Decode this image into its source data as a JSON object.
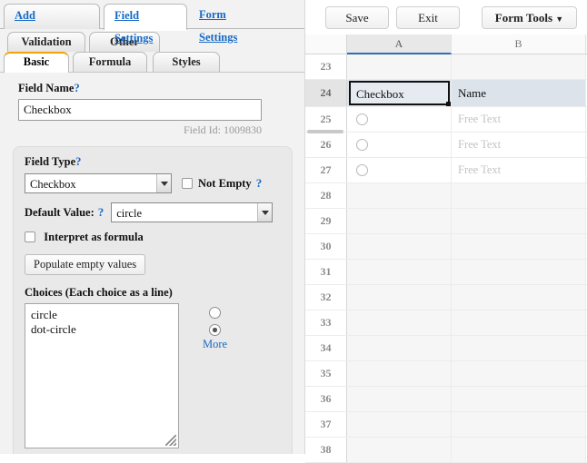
{
  "left_panel": {
    "top_tabs": [
      {
        "label": "Add Components",
        "active": false
      },
      {
        "label": "Field Settings",
        "active": true
      },
      {
        "label": "Form Settings",
        "active": false
      }
    ],
    "sub_tabs_row1": [
      {
        "label": "Validation"
      },
      {
        "label": "Other"
      }
    ],
    "sub_tabs_row2": [
      {
        "label": "Basic",
        "active": true
      },
      {
        "label": "Formula",
        "active": false
      },
      {
        "label": "Styles",
        "active": false
      }
    ],
    "field_name": {
      "label": "Field Name",
      "help": "?",
      "value": "Checkbox",
      "field_id_text": "Field Id: 1009830"
    },
    "field_type": {
      "label": "Field Type",
      "help": "?",
      "value": "Checkbox",
      "not_empty_label": "Not Empty",
      "not_empty_help": "?",
      "not_empty_checked": false
    },
    "default_value": {
      "label": "Default Value:",
      "help": "?",
      "value": "circle",
      "interpret_label": "Interpret as formula",
      "interpret_checked": false
    },
    "populate_button": "Populate empty values",
    "choices": {
      "label": "Choices (Each choice as a line)",
      "value": "circle\ndot-circle",
      "preview_icons": [
        "circle",
        "dot-circle"
      ],
      "more_label": "More"
    }
  },
  "right_panel": {
    "toolbar": {
      "save": "Save",
      "exit": "Exit",
      "form_tools": "Form Tools",
      "form_tools_caret": "▼"
    },
    "grid": {
      "columns": [
        {
          "label": "A",
          "selected": true
        },
        {
          "label": "B",
          "selected": false
        }
      ],
      "rows": [
        {
          "num": "23",
          "type": "empty",
          "a": "",
          "b": ""
        },
        {
          "num": "24",
          "type": "header",
          "a": "Checkbox",
          "b": "Name"
        },
        {
          "num": "25",
          "type": "data",
          "a": "radio",
          "b": "Free Text"
        },
        {
          "num": "26",
          "type": "data",
          "a": "radio",
          "b": "Free Text"
        },
        {
          "num": "27",
          "type": "data",
          "a": "radio",
          "b": "Free Text"
        },
        {
          "num": "28",
          "type": "empty",
          "a": "",
          "b": ""
        },
        {
          "num": "29",
          "type": "empty",
          "a": "",
          "b": ""
        },
        {
          "num": "30",
          "type": "empty",
          "a": "",
          "b": ""
        },
        {
          "num": "31",
          "type": "empty",
          "a": "",
          "b": ""
        },
        {
          "num": "32",
          "type": "empty",
          "a": "",
          "b": ""
        },
        {
          "num": "33",
          "type": "empty",
          "a": "",
          "b": ""
        },
        {
          "num": "34",
          "type": "empty",
          "a": "",
          "b": ""
        },
        {
          "num": "35",
          "type": "empty",
          "a": "",
          "b": ""
        },
        {
          "num": "36",
          "type": "empty",
          "a": "",
          "b": ""
        },
        {
          "num": "37",
          "type": "empty",
          "a": "",
          "b": ""
        },
        {
          "num": "38",
          "type": "empty",
          "a": "",
          "b": ""
        }
      ]
    }
  },
  "colors": {
    "link": "#1569C7",
    "active_tab_accent": "#F0A30A",
    "column_selected_underline": "#2f6fb5",
    "selected_row_bg": "#dde3ea",
    "placeholder": "#c3c3c3"
  }
}
